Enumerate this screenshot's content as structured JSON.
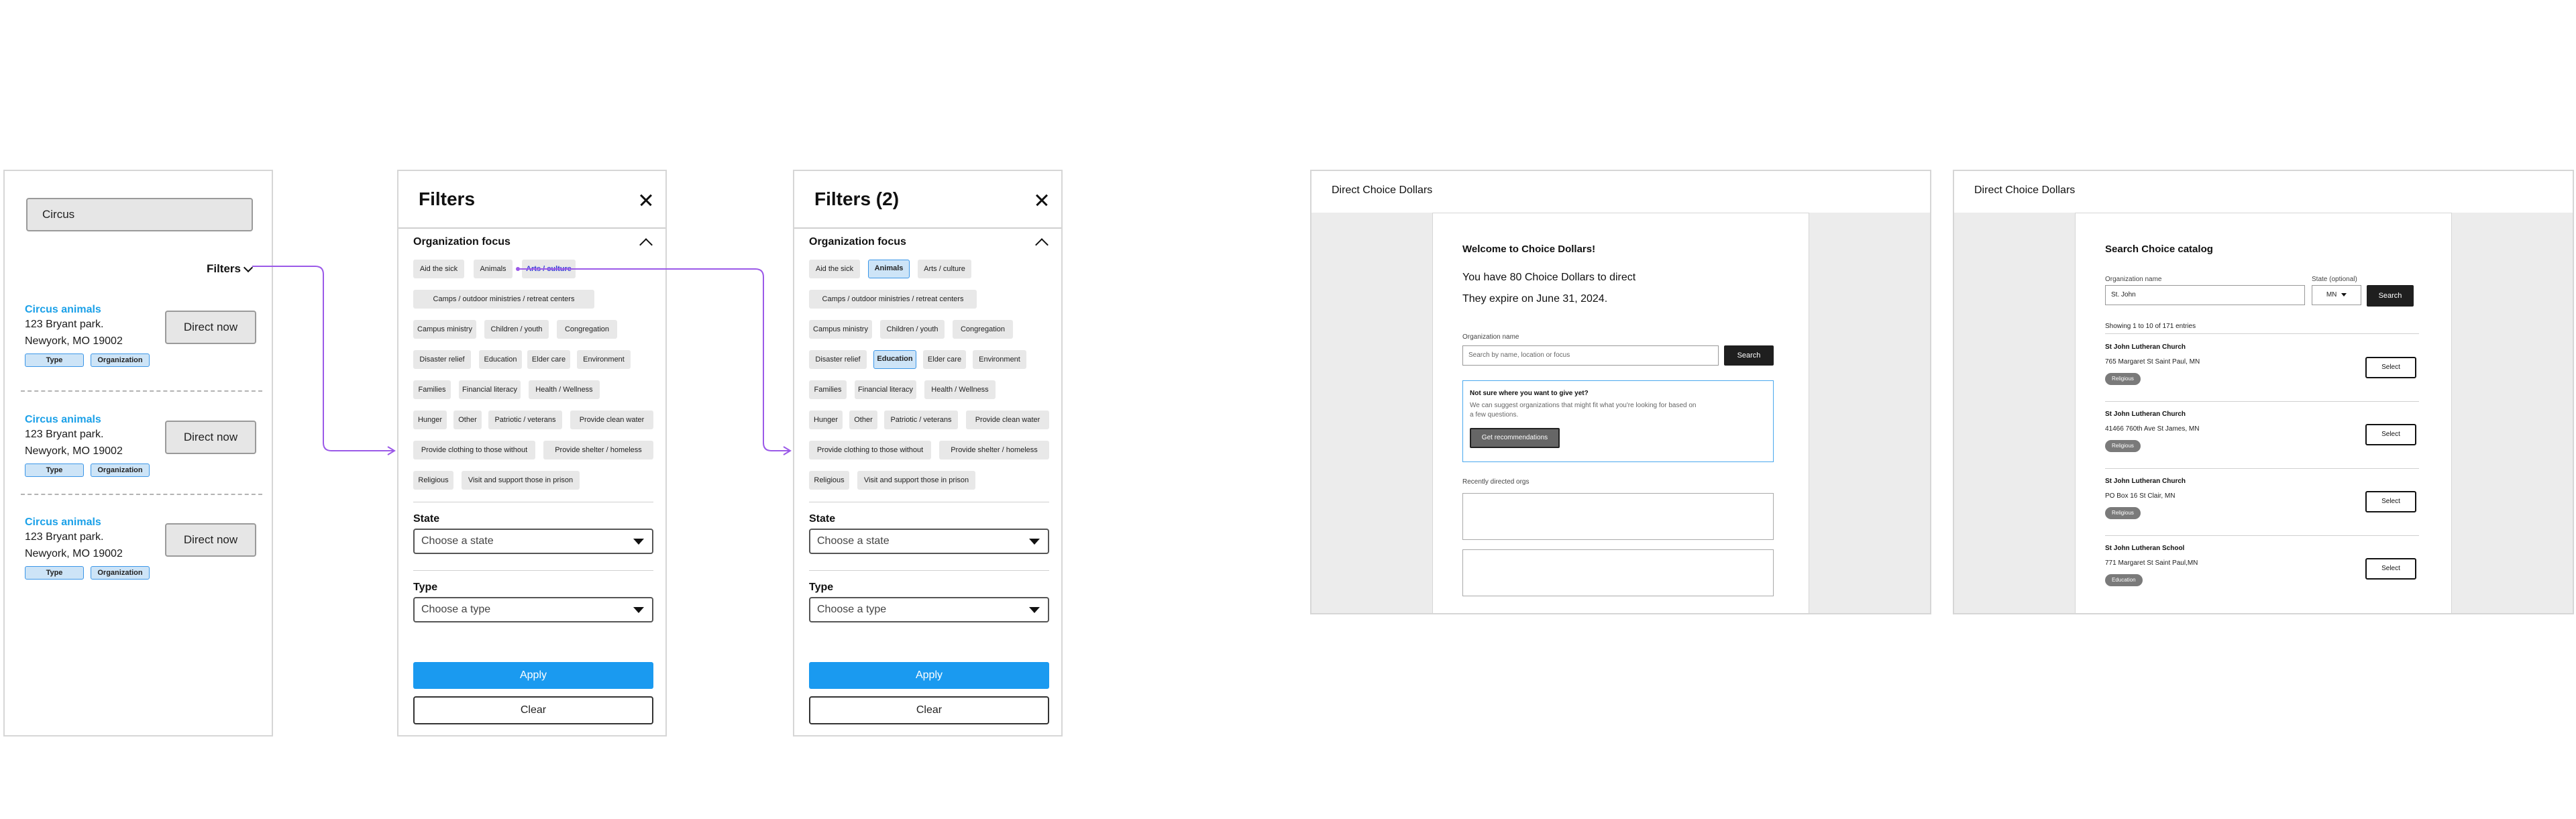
{
  "results_screen": {
    "search_value": "Circus",
    "filters_label": "Filters",
    "results": [
      {
        "name": "Circus animals",
        "address1": "123 Bryant park.",
        "address2": "Newyork, MO 19002",
        "tag_type": "Type",
        "tag_org": "Organization",
        "action": "Direct now"
      },
      {
        "name": "Circus animals",
        "address1": "123 Bryant park.",
        "address2": "Newyork, MO 19002",
        "tag_type": "Type",
        "tag_org": "Organization",
        "action": "Direct now"
      },
      {
        "name": "Circus animals",
        "address1": "123 Bryant park.",
        "address2": "Newyork, MO 19002",
        "tag_type": "Type",
        "tag_org": "Organization",
        "action": "Direct now"
      }
    ]
  },
  "filters_a": {
    "title": "Filters",
    "section": "Organization focus",
    "chips": [
      "Aid the sick",
      "Animals",
      "Arts / culture",
      "Camps / outdoor ministries / retreat centers",
      "Campus ministry",
      "Children / youth",
      "Congregation",
      "Disaster relief",
      "Education",
      "Elder care",
      "Environment",
      "Families",
      "Financial literacy",
      "Health / Wellness",
      "Hunger",
      "Other",
      "Patriotic / veterans",
      "Provide clean water",
      "Provide clothing to those without",
      "Provide shelter / homeless",
      "Religious",
      "Visit and support those in prison"
    ],
    "state_label": "State",
    "state_placeholder": "Choose a state",
    "type_label": "Type",
    "type_placeholder": "Choose a type",
    "apply": "Apply",
    "clear": "Clear"
  },
  "filters_b": {
    "title": "Filters (2)",
    "section": "Organization focus",
    "chips": [
      "Aid the sick",
      "Animals",
      "Arts / culture",
      "Camps / outdoor ministries / retreat centers",
      "Campus ministry",
      "Children / youth",
      "Congregation",
      "Disaster relief",
      "Education",
      "Elder care",
      "Environment",
      "Families",
      "Financial literacy",
      "Health / Wellness",
      "Hunger",
      "Other",
      "Patriotic / veterans",
      "Provide clean water",
      "Provide clothing to those without",
      "Provide shelter / homeless",
      "Religious",
      "Visit and support those in prison"
    ],
    "selected": [
      "Animals",
      "Education"
    ],
    "state_label": "State",
    "state_placeholder": "Choose a state",
    "type_label": "Type",
    "type_placeholder": "Choose a type",
    "apply": "Apply",
    "clear": "Clear"
  },
  "welcome_page": {
    "brand": "Direct Choice Dollars",
    "heading": "Welcome to Choice Dollars!",
    "dollars_line": "You have 80 Choice Dollars to direct",
    "expire_line": "They expire on June 31, 2024.",
    "org_label": "Organization name",
    "search_placeholder": "Search by name, location or focus",
    "search_button": "Search",
    "rec_title": "Not sure where you want to give yet?",
    "rec_desc": "We can suggest organizations that might fit what you're looking for based on a few questions.",
    "rec_button": "Get recommendations",
    "recent_label": "Recently directed orgs"
  },
  "catalog_page": {
    "brand": "Direct Choice Dollars",
    "heading": "Search Choice catalog",
    "org_label": "Organization name",
    "org_value": "St. John",
    "state_label": "State (optional)",
    "state_value": "MN",
    "search_button": "Search",
    "showing": "Showing 1 to 10 of 171 entries",
    "select_label": "Select",
    "rows": [
      {
        "name": "St John Lutheran Church",
        "address": "765 Margaret St Saint Paul, MN",
        "badge": "Religious"
      },
      {
        "name": "St John Lutheran Church",
        "address": "41466 760th Ave St James, MN",
        "badge": "Religious"
      },
      {
        "name": "St John Lutheran Church",
        "address": "PO Box 16 St Clair, MN",
        "badge": "Religious"
      },
      {
        "name": "St John Lutheran School",
        "address": "771 Margaret St Saint Paul,MN",
        "badge": "Education"
      }
    ]
  },
  "colors": {
    "accent_blue": "#1a9af0",
    "link_blue": "#1aa0e8",
    "tag_fill": "#cde4f7",
    "connector": "#9b59e8"
  }
}
